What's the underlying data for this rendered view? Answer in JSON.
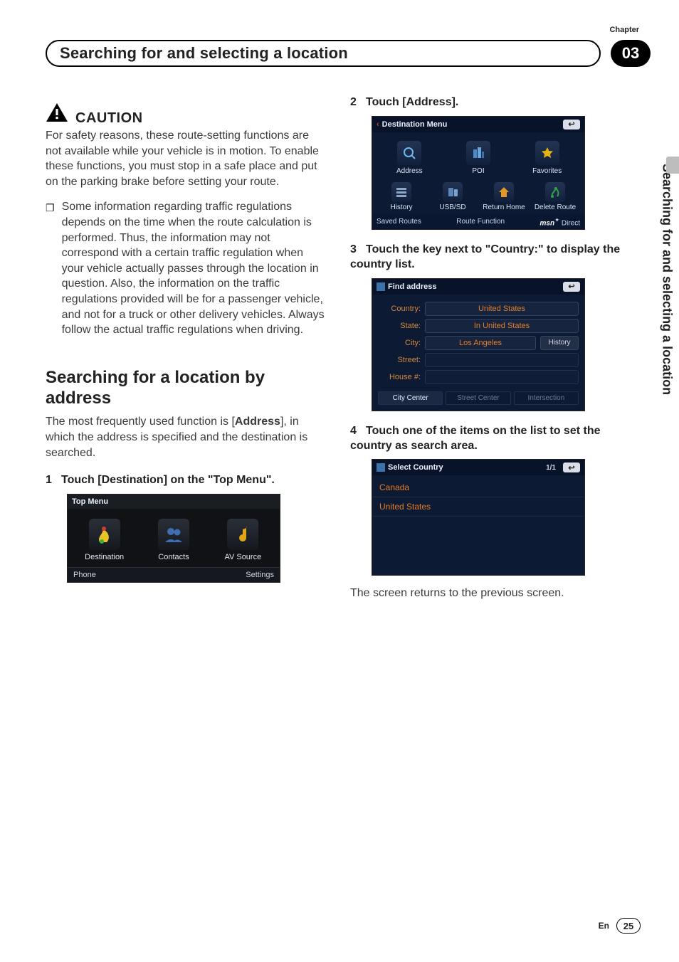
{
  "header": {
    "chapter_label": "Chapter",
    "chapter_number": "03",
    "title": "Searching for and selecting a location",
    "side_tab": "Searching for and selecting a location"
  },
  "left": {
    "caution_label": "CAUTION",
    "caution_body": "For safety reasons, these route-setting functions are not available while your vehicle is in motion. To enable these functions, you must stop in a safe place and put on the parking brake before setting your route.",
    "bullet_body": "Some information regarding traffic regulations depends on the time when the route calculation is performed. Thus, the information may not correspond with a certain traffic regulation when your vehicle actually passes through the location in question. Also, the information on the traffic regulations provided will be for a passenger vehicle, and not for a truck or other delivery vehicles. Always follow the actual traffic regulations when driving.",
    "section_title": "Searching for a location by address",
    "section_body_pre": "The most frequently used function is [",
    "section_body_bold": "Address",
    "section_body_post": "], in which the address is specified and the destination is searched.",
    "step1": "Touch [Destination] on the \"Top Menu\".",
    "top_menu": {
      "title": "Top Menu",
      "items": [
        "Destination",
        "Contacts",
        "AV Source"
      ],
      "footer_left": "Phone",
      "footer_right": "Settings"
    }
  },
  "right": {
    "step2": "Touch [Address].",
    "dest_menu": {
      "title": "Destination Menu",
      "row1": [
        "Address",
        "POI",
        "Favorites"
      ],
      "row2": [
        "History",
        "USB/SD",
        "Return Home",
        "Delete Route"
      ],
      "footer_left": "Saved Routes",
      "footer_mid": "Route Function",
      "msn_prefix": "msn",
      "msn_suffix": "Direct"
    },
    "step3": "Touch the key next to \"Country:\" to display the country list.",
    "find_address": {
      "title": "Find address",
      "country_label": "Country:",
      "country_value": "United States",
      "state_label": "State:",
      "state_value": "In United States",
      "city_label": "City:",
      "city_value": "Los Angeles",
      "history": "History",
      "street_label": "Street:",
      "house_label": "House #:",
      "footer": [
        "City Center",
        "Street Center",
        "Intersection"
      ]
    },
    "step4": "Touch one of the items on the list to set the country as search area.",
    "select_country": {
      "title": "Select Country",
      "page": "1/1",
      "items": [
        "Canada",
        "United States"
      ]
    },
    "after_text": "The screen returns to the previous screen."
  },
  "footer": {
    "lang": "En",
    "page": "25"
  }
}
